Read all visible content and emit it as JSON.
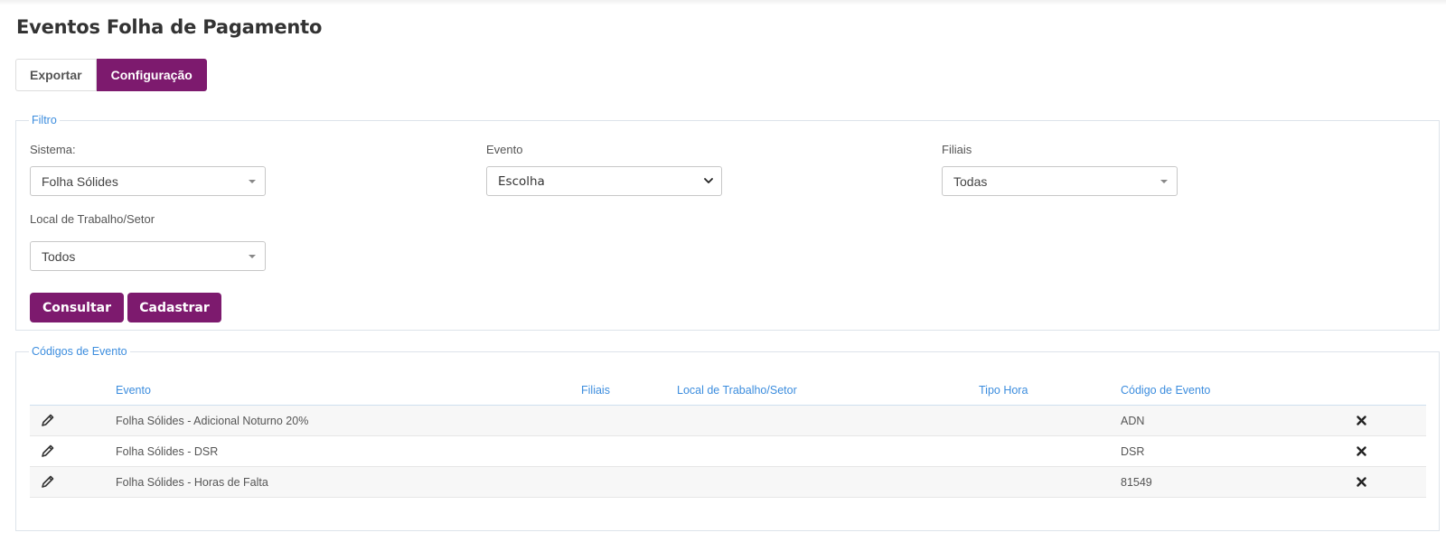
{
  "page": {
    "title": "Eventos Folha de Pagamento"
  },
  "tabs": [
    {
      "label": "Exportar",
      "active": false
    },
    {
      "label": "Configuração",
      "active": true
    }
  ],
  "filtro": {
    "legend": "Filtro",
    "sistema": {
      "label": "Sistema:",
      "value": "Folha Sólides"
    },
    "evento": {
      "label": "Evento",
      "value": "Escolha"
    },
    "filiais": {
      "label": "Filiais",
      "value": "Todas"
    },
    "local": {
      "label": "Local de Trabalho/Setor",
      "value": "Todos"
    },
    "buttons": {
      "consultar": "Consultar",
      "cadastrar": "Cadastrar"
    }
  },
  "codigos": {
    "legend": "Códigos de Evento",
    "columns": {
      "evento": "Evento",
      "filiais": "Filiais",
      "local": "Local de Trabalho/Setor",
      "tipo_hora": "Tipo Hora",
      "codigo": "Código de Evento"
    },
    "rows": [
      {
        "evento": "Folha Sólides - Adicional Noturno 20%",
        "filiais": "",
        "local": "",
        "tipo_hora": "",
        "codigo": "ADN"
      },
      {
        "evento": "Folha Sólides - DSR",
        "filiais": "",
        "local": "",
        "tipo_hora": "",
        "codigo": "DSR"
      },
      {
        "evento": "Folha Sólides - Horas de Falta",
        "filiais": "",
        "local": "",
        "tipo_hora": "",
        "codigo": "81549"
      }
    ]
  },
  "colors": {
    "primary": "#7d1a6e",
    "link": "#3c8dde"
  },
  "icons": {
    "edit": "pencil-icon",
    "delete": "close-icon"
  }
}
